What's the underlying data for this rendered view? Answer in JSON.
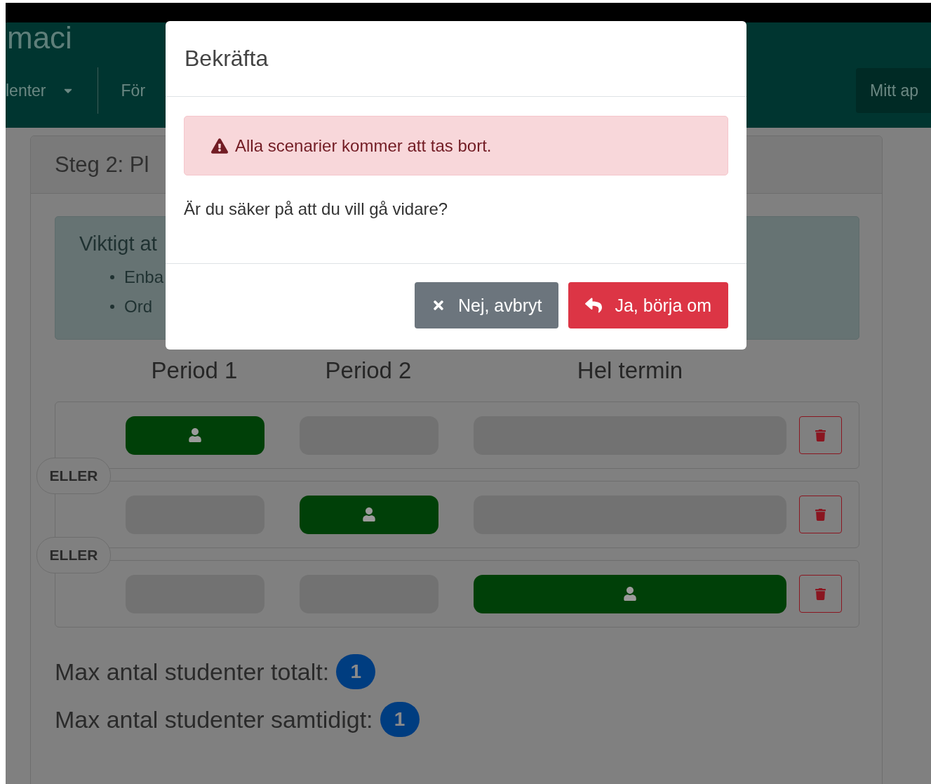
{
  "header": {
    "brand": "maci",
    "nav": [
      {
        "label": "lenter",
        "dropdown": true
      },
      {
        "label": "För",
        "dropdown": false
      }
    ],
    "account_button": "Mitt ap"
  },
  "card": {
    "title": "Steg 2: Pl",
    "info": {
      "title": "Viktigt at",
      "items": [
        "Enba",
        "Ord"
      ]
    },
    "columns": [
      "Period 1",
      "Period 2",
      "Hel termin"
    ],
    "rows": [
      {
        "slots": [
          {
            "filled": true
          },
          {
            "filled": false
          },
          {
            "filled": false
          }
        ]
      },
      {
        "slots": [
          {
            "filled": false
          },
          {
            "filled": true
          },
          {
            "filled": false
          }
        ]
      },
      {
        "slots": [
          {
            "filled": false
          },
          {
            "filled": false
          },
          {
            "filled": true
          }
        ]
      }
    ],
    "separators": [
      "ELLER",
      "ELLER"
    ],
    "totals": [
      {
        "label": "Max antal studenter totalt:",
        "count": "1"
      },
      {
        "label": "Max antal studenter samtidigt:",
        "count": "1"
      }
    ]
  },
  "dialog": {
    "title": "Bekräfta",
    "alert": "Alla scenarier kommer att tas bort.",
    "question": "Är du säker på att du vill gå vidare?",
    "buttons": [
      {
        "label": "Nej, avbryt",
        "kind": "cancel"
      },
      {
        "label": "Ja, börja om",
        "kind": "confirm"
      }
    ]
  }
}
